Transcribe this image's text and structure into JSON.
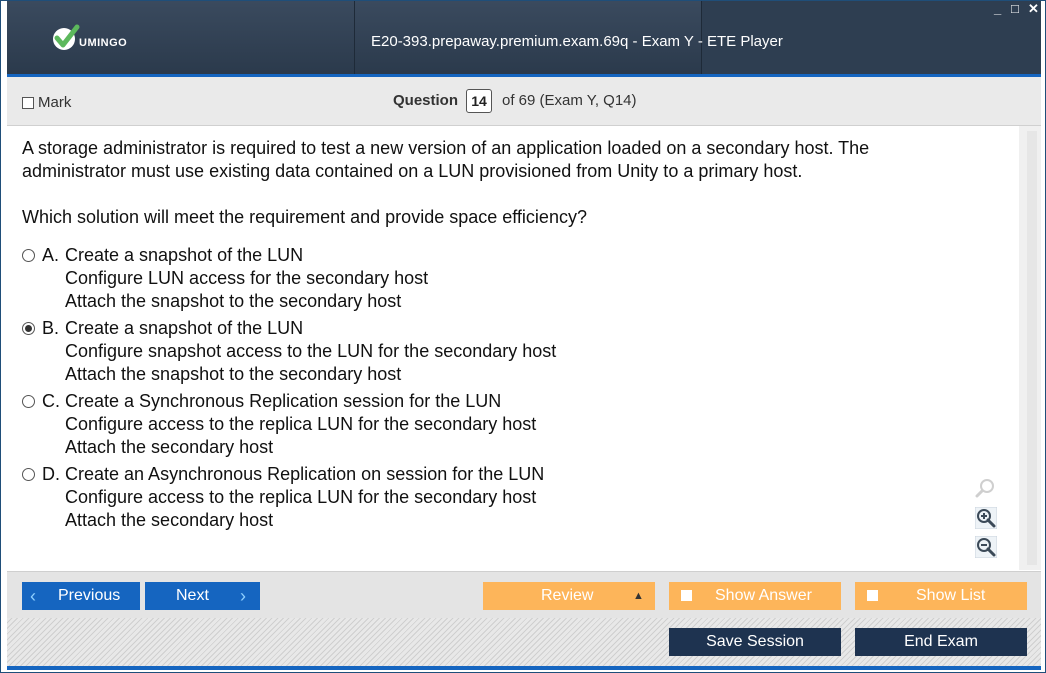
{
  "window": {
    "title": "E20-393.prepaway.premium.exam.69q - Exam Y - ETE Player",
    "logo_text": "UMINGO",
    "controls": [
      "minimize",
      "maximize",
      "close"
    ]
  },
  "header": {
    "mark_label": "Mark",
    "question_label": "Question",
    "question_number": "14",
    "of_text": "of 69 (Exam Y, Q14)"
  },
  "question": {
    "text_line1": "A storage administrator is required to test a new version of an application loaded on a secondary host. The",
    "text_line2": "administrator must use existing data contained on a LUN provisioned from Unity to a primary host.",
    "prompt": "Which solution will meet the requirement and provide space efficiency?",
    "options": [
      {
        "letter": "A.",
        "lines": [
          "Create a snapshot of the LUN",
          "Configure LUN access for the secondary host",
          "Attach the snapshot to the secondary host"
        ],
        "selected": false
      },
      {
        "letter": "B.",
        "lines": [
          "Create a snapshot of the LUN",
          "Configure snapshot access to the LUN for the secondary host",
          "Attach the snapshot to the secondary host"
        ],
        "selected": true
      },
      {
        "letter": "C.",
        "lines": [
          "Create a Synchronous Replication session for the LUN",
          "Configure access to the replica LUN for the secondary host",
          "Attach the secondary host"
        ],
        "selected": false
      },
      {
        "letter": "D.",
        "lines": [
          "Create an Asynchronous Replication on session for the LUN",
          "Configure access to the replica LUN for the secondary host",
          "Attach the secondary host"
        ],
        "selected": false
      }
    ]
  },
  "nav": {
    "previous_label": "Previous",
    "next_label": "Next",
    "review_label": "Review",
    "show_answer_label": "Show Answer",
    "show_list_label": "Show List",
    "save_session_label": "Save Session",
    "end_exam_label": "End Exam"
  },
  "icons": {
    "search": "search-icon",
    "zoom_in": "zoom-in-icon",
    "zoom_out": "zoom-out-icon"
  },
  "colors": {
    "titlebar": "#2e3e51",
    "accent_blue": "#1565c0",
    "orange": "#fdb55a",
    "dark_button": "#1e3350"
  }
}
